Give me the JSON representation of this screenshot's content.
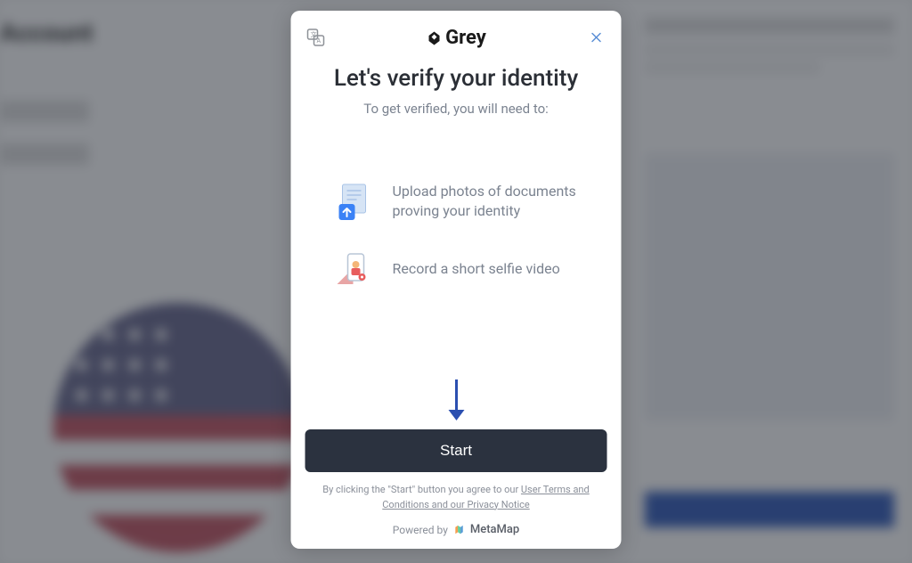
{
  "brand": "Grey",
  "modal": {
    "title": "Let's verify your identity",
    "subtitle": "To get verified, you will need to:",
    "steps": [
      {
        "text": "Upload photos of documents proving your identity"
      },
      {
        "text": "Record a short selfie video"
      }
    ],
    "startButton": "Start",
    "disclaimer": {
      "preText": "By clicking the \"Start\" button you agree to our ",
      "link": "User Terms and Conditions and our Privacy Notice"
    },
    "poweredBy": {
      "label": "Powered by",
      "brand": "MetaMap"
    }
  },
  "colors": {
    "accentDark": "#2b323f",
    "textMuted": "#7b8390",
    "closeIcon": "#5b8fd6"
  }
}
